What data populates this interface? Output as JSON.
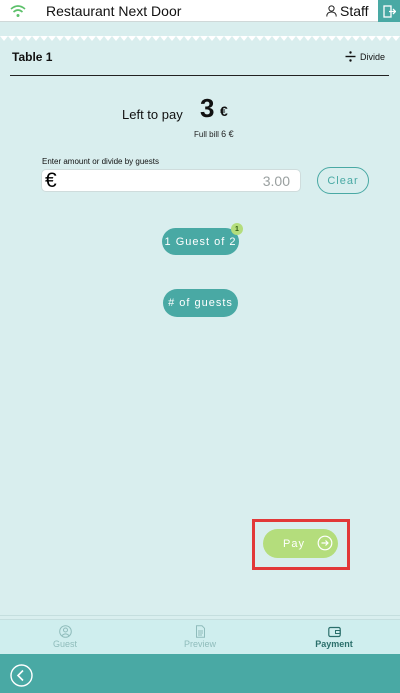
{
  "header": {
    "title": "Restaurant Next Door",
    "staff_label": "Staff"
  },
  "table": {
    "title": "Table 1",
    "divide_label": "Divide"
  },
  "summary": {
    "left_to_pay_label": "Left to pay",
    "left_to_pay_amount": "3",
    "currency": "€",
    "full_bill_label": "Full bill",
    "full_bill_value": "6 €"
  },
  "entry": {
    "label": "Enter amount or divide by guests",
    "currency_symbol": "€",
    "placeholder": "3.00",
    "clear_label": "Clear"
  },
  "guests": {
    "guest_pill_label": "1 Guest of 2",
    "guest_badge": "1",
    "num_guests_label": "# of guests"
  },
  "pay": {
    "label": "Pay"
  },
  "nav": {
    "guest": "Guest",
    "preview": "Preview",
    "payment": "Payment"
  },
  "colors": {
    "accent": "#49a9a4",
    "pay_green": "#b4dd7c",
    "highlight": "#e23838",
    "background": "#d9eeee"
  }
}
